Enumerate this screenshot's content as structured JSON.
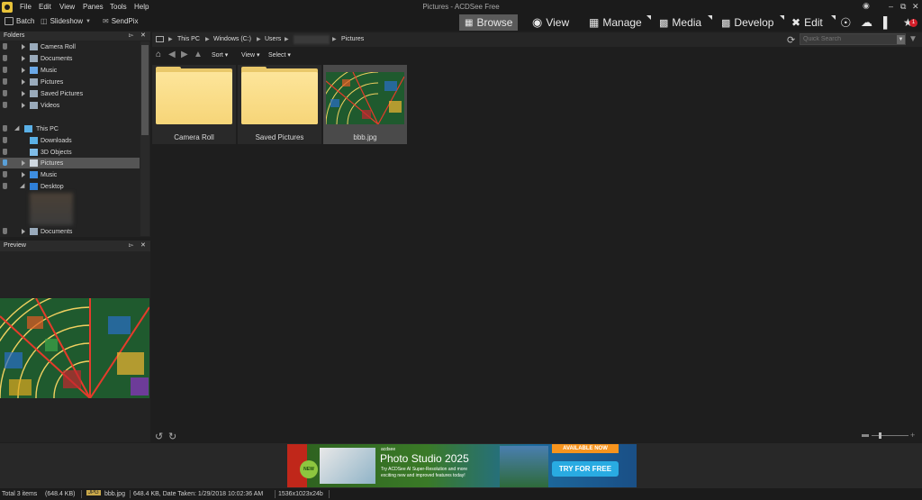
{
  "window": {
    "title": "Pictures - ACDSee Free"
  },
  "menu": [
    "File",
    "Edit",
    "View",
    "Panes",
    "Tools",
    "Help"
  ],
  "toolbar": {
    "batch": "Batch",
    "slideshow": "Slideshow",
    "sendpix": "SendPix"
  },
  "modes": {
    "browse": "Browse",
    "view": "View",
    "manage": "Manage",
    "media": "Media",
    "develop": "Develop",
    "edit": "Edit"
  },
  "notification_count": "1",
  "folders_pane": {
    "title": "Folders",
    "items": [
      "Camera Roll",
      "Documents",
      "Music",
      "Pictures",
      "Saved Pictures",
      "Videos",
      "This PC",
      "Downloads",
      "3D Objects",
      "Pictures",
      "Music",
      "Desktop",
      "Documents"
    ]
  },
  "preview_pane": {
    "title": "Preview"
  },
  "breadcrumb": [
    "This PC",
    "Windows (C:)",
    "Users",
    "",
    "Pictures"
  ],
  "search": {
    "placeholder": "Quick Search"
  },
  "nav": {
    "sort": "Sort",
    "view": "View",
    "select": "Select"
  },
  "files": [
    {
      "name": "Camera Roll",
      "type": "folder"
    },
    {
      "name": "Saved Pictures",
      "type": "folder"
    },
    {
      "name": "bbb.jpg",
      "type": "image"
    }
  ],
  "ad": {
    "brand": "acdsee",
    "product": "Photo Studio 2025",
    "line1": "Try ACDSee AI Super-Resolution and more",
    "line2": "exciting new and improved features today!",
    "badge": "AVAILABLE NOW",
    "cta": "TRY FOR FREE",
    "new_badge": "NEW"
  },
  "status": {
    "total": "Total 3 items",
    "total_size": "(648.4 KB)",
    "ext": "JPG",
    "filename": "bbb.jpg",
    "details": "648.4 KB, Date Taken: 1/29/2018 10:02:36 AM",
    "dimensions": "1536x1023x24b"
  },
  "colors": {
    "accent_folder": "#f6d578",
    "selected_row": "#555555",
    "ad_orange": "#f7941d",
    "ad_cta": "#29abe2"
  }
}
